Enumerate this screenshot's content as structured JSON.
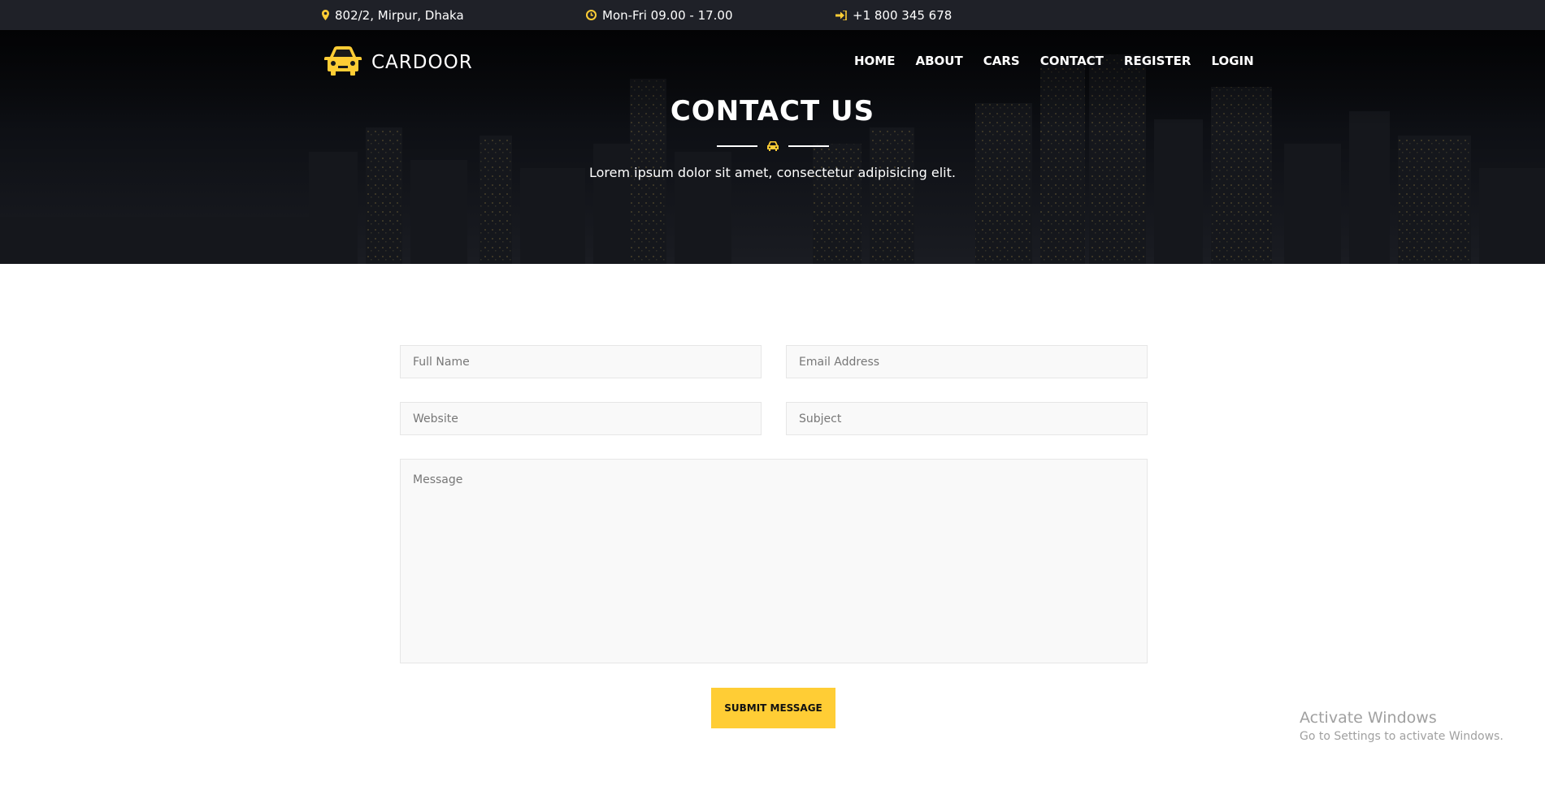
{
  "topbar": {
    "address": "802/2, Mirpur, Dhaka",
    "hours": "Mon-Fri 09.00 - 17.00",
    "phone": "+1 800 345 678"
  },
  "brand": {
    "name": "CARDOOR"
  },
  "nav": {
    "items": [
      {
        "label": "HOME"
      },
      {
        "label": "ABOUT"
      },
      {
        "label": "CARS"
      },
      {
        "label": "CONTACT"
      },
      {
        "label": "REGISTER"
      },
      {
        "label": "LOGIN"
      }
    ]
  },
  "hero": {
    "title": "CONTACT US",
    "subtitle": "Lorem ipsum dolor sit amet, consectetur adipisicing elit."
  },
  "form": {
    "full_name_placeholder": "Full Name",
    "email_placeholder": "Email Address",
    "website_placeholder": "Website",
    "subject_placeholder": "Subject",
    "message_placeholder": "Message",
    "submit_label": "SUBMIT MESSAGE"
  },
  "watermark": {
    "title": "Activate Windows",
    "subtitle": "Go to Settings to activate Windows."
  },
  "colors": {
    "accent": "#ffcd35",
    "topbar": "#1f2128"
  },
  "icons": [
    "map-marker-icon",
    "clock-icon",
    "sign-in-icon",
    "car-logo-icon",
    "car-icon"
  ]
}
